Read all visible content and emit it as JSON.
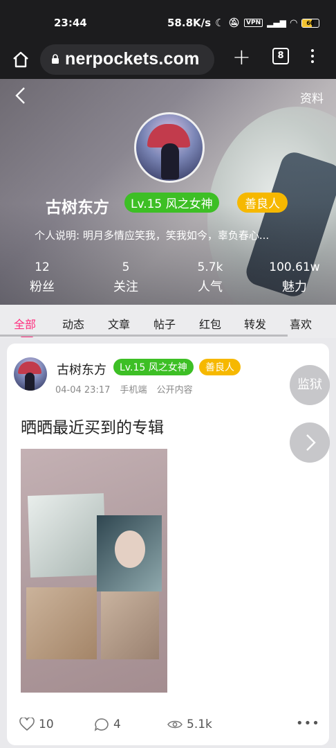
{
  "statusbar": {
    "time": "23:44",
    "network_speed": "58.8K/s",
    "vpn": "VPN",
    "battery": "60"
  },
  "browser": {
    "url": "nerpockets.com",
    "tab_count": "8"
  },
  "profile": {
    "info_link": "资料",
    "username": "古树东方",
    "level_badge": "Lv.15 风之女神",
    "trait_badge": "善良人",
    "bio": "个人说明: 明月多情应笑我，笑我如今，辜负春心...",
    "stats": [
      {
        "value": "12",
        "label": "粉丝"
      },
      {
        "value": "5",
        "label": "关注"
      },
      {
        "value": "5.7k",
        "label": "人气"
      },
      {
        "value": "100.61w",
        "label": "魅力"
      }
    ]
  },
  "tabs": [
    {
      "label": "全部",
      "active": true
    },
    {
      "label": "动态"
    },
    {
      "label": "文章"
    },
    {
      "label": "帖子"
    },
    {
      "label": "红包"
    },
    {
      "label": "转发"
    },
    {
      "label": "喜欢"
    }
  ],
  "post": {
    "author": "古树东方",
    "level_badge": "Lv.15 风之女神",
    "trait_badge": "善良人",
    "date": "04-04 23:17",
    "device": "手机端",
    "visibility": "公开内容",
    "title": "晒晒最近买到的专辑",
    "likes": "10",
    "comments": "4",
    "views": "5.1k"
  },
  "floating": {
    "jail_label": "监狱"
  },
  "colors": {
    "accent": "#ff2e7e",
    "level_green": "#3dbf25",
    "trait_yellow": "#f6b800"
  }
}
